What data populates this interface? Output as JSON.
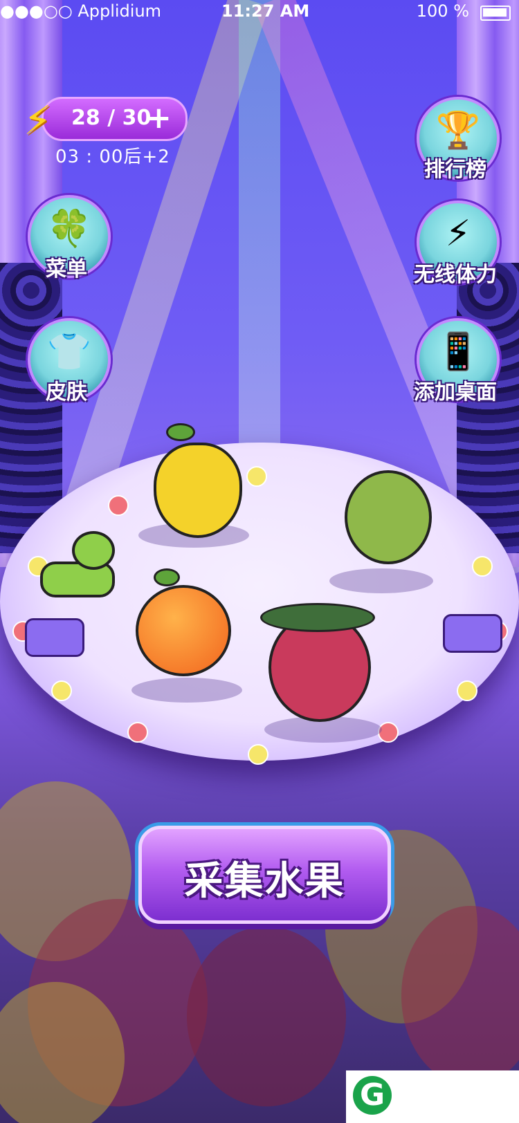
{
  "status_bar": {
    "carrier": "●●●○○ Applidium",
    "time": "11:27 AM",
    "battery": "100 %"
  },
  "energy": {
    "value": "28 / 30",
    "plus": "+",
    "timer": "03 : 00后+2"
  },
  "menu": {
    "leaderboard": "排行榜",
    "menu": "菜单",
    "unlimited_stamina": "无线体力",
    "skin": "皮肤",
    "add_to_desktop": "添加桌面"
  },
  "icons": {
    "leaderboard": "trophy-icon",
    "menu": "clover-icon",
    "stamina": "lightning-icon",
    "skin": "tshirt-icon",
    "desktop": "phone-icon"
  },
  "collect_button": "采集水果",
  "colors": {
    "accent": "#b25cf0",
    "energy_bolt": "#ffd21f",
    "button_face": "#7ad5de"
  }
}
